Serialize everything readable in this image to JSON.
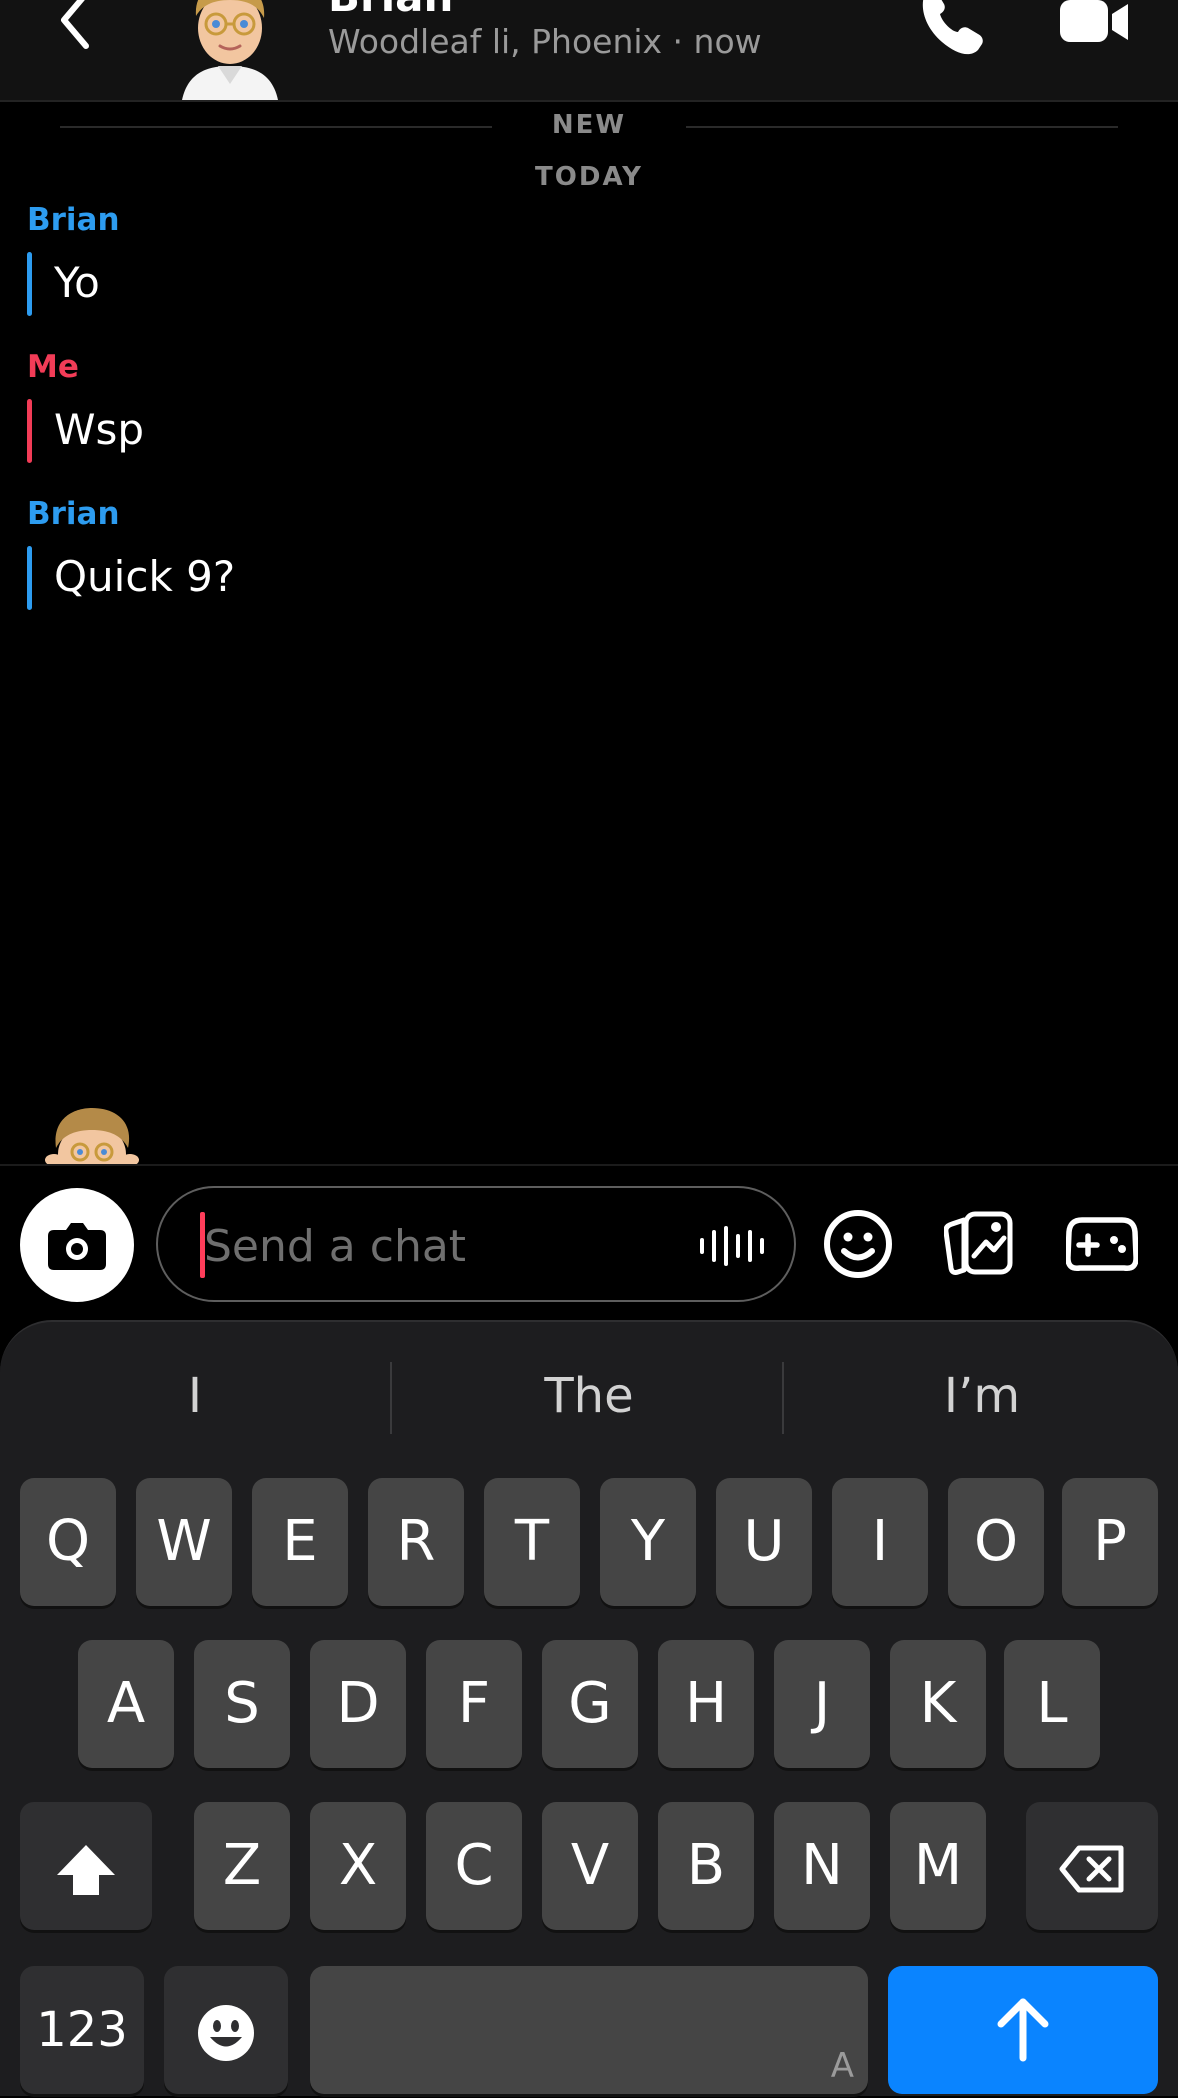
{
  "header": {
    "contact_name": "Brian",
    "status": "Woodleaf li, Phoenix · now"
  },
  "dividers": {
    "new": "NEW",
    "today": "TODAY"
  },
  "messages": [
    {
      "sender": "Brian",
      "text": "Yo",
      "color": "#2d9cf0"
    },
    {
      "sender": "Me",
      "text": "Wsp",
      "color": "#f23c57"
    },
    {
      "sender": "Brian",
      "text": "Quick 9?",
      "color": "#2d9cf0"
    }
  ],
  "input": {
    "placeholder": "Send a chat",
    "value": ""
  },
  "keyboard": {
    "suggestions": [
      "I",
      "The",
      "I’m"
    ],
    "row1": [
      "Q",
      "W",
      "E",
      "R",
      "T",
      "Y",
      "U",
      "I",
      "O",
      "P"
    ],
    "row2": [
      "A",
      "S",
      "D",
      "F",
      "G",
      "H",
      "J",
      "K",
      "L"
    ],
    "row3": [
      "Z",
      "X",
      "C",
      "V",
      "B",
      "N",
      "M"
    ],
    "numbers_label": "123",
    "space_mark": "A"
  },
  "colors": {
    "brian": "#2d9cf0",
    "me": "#f23c57",
    "send_key": "#0a84ff"
  },
  "icons": [
    "back-icon",
    "phone-icon",
    "video-icon",
    "camera-icon",
    "voice-icon",
    "smiley-icon",
    "sticker-icon",
    "game-controller-icon",
    "shift-icon",
    "backspace-icon",
    "emoji-icon",
    "send-arrow-icon"
  ]
}
